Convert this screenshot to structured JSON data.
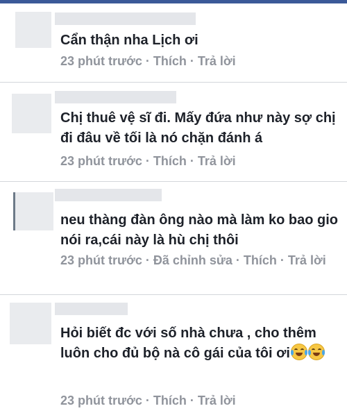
{
  "comments": [
    {
      "text": "Cẩn thận nha Lịch ơi",
      "meta": {
        "time": "23 phút trước",
        "like": "Thích",
        "reply": "Trả lời"
      }
    },
    {
      "text": "Chị thuê vệ sĩ đi. Mấy đứa như này sợ chị đi đâu về tối là nó chặn đánh á",
      "meta": {
        "time": "23 phút trước",
        "like": "Thích",
        "reply": "Trả lời"
      }
    },
    {
      "text": "neu thàng đàn ông nào mà làm ko bao gio nói ra,cái này là hù chị thôi",
      "meta": {
        "time": "23 phút trước",
        "edited": "Đã chỉnh sửa",
        "like": "Thích",
        "reply": "Trả lời"
      }
    },
    {
      "text": "Hỏi biết đc với số nhà chưa , cho thêm luôn cho đủ bộ nà cô gái của tôi ơi",
      "emojis": [
        "joy-emoji",
        "joy-emoji"
      ],
      "meta": {
        "time": "23 phút trước",
        "like": "Thích",
        "reply": "Trả lời"
      }
    }
  ],
  "separator": " · ",
  "colors": {
    "text": "#1d2129",
    "meta": "#90949c",
    "divider": "#d3d6db",
    "topbar": "#3b5998"
  }
}
